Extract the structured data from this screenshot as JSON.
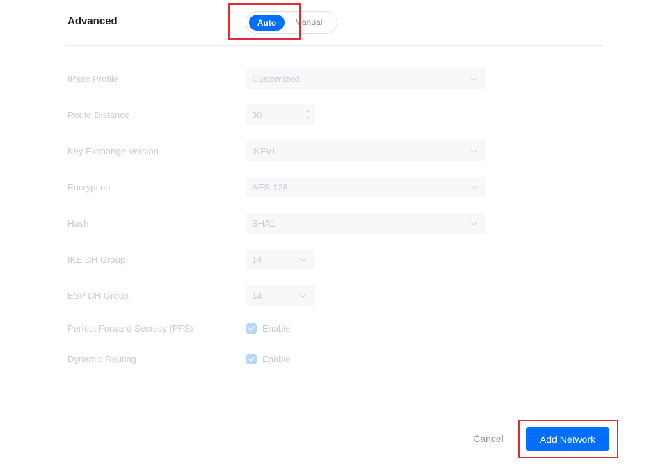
{
  "section": {
    "title": "Advanced"
  },
  "mode_toggle": {
    "auto_label": "Auto",
    "manual_label": "Manual",
    "selected": "Auto"
  },
  "fields": {
    "ipsec_profile": {
      "label": "IPsec Profile",
      "value": "Customized"
    },
    "route_distance": {
      "label": "Route Distance",
      "value": "30"
    },
    "key_exchange_version": {
      "label": "Key Exchange Version",
      "value": "IKEv1"
    },
    "encryption": {
      "label": "Encryption",
      "value": "AES-128"
    },
    "hash": {
      "label": "Hash",
      "value": "SHA1"
    },
    "ike_dh_group": {
      "label": "IKE DH Group",
      "value": "14"
    },
    "esp_dh_group": {
      "label": "ESP DH Group",
      "value": "14"
    },
    "pfs": {
      "label": "Perfect Forward Secrecy (PFS)",
      "checkbox_label": "Enable",
      "checked": true
    },
    "dynamic_routing": {
      "label": "Dynamic Routing",
      "checkbox_label": "Enable",
      "checked": true
    }
  },
  "footer": {
    "cancel_label": "Cancel",
    "submit_label": "Add Network"
  },
  "colors": {
    "accent": "#006fff",
    "highlight": "#e02b35",
    "disabled_text": "#c9ccd1",
    "checkbox_disabled": "#b8d6fd"
  }
}
